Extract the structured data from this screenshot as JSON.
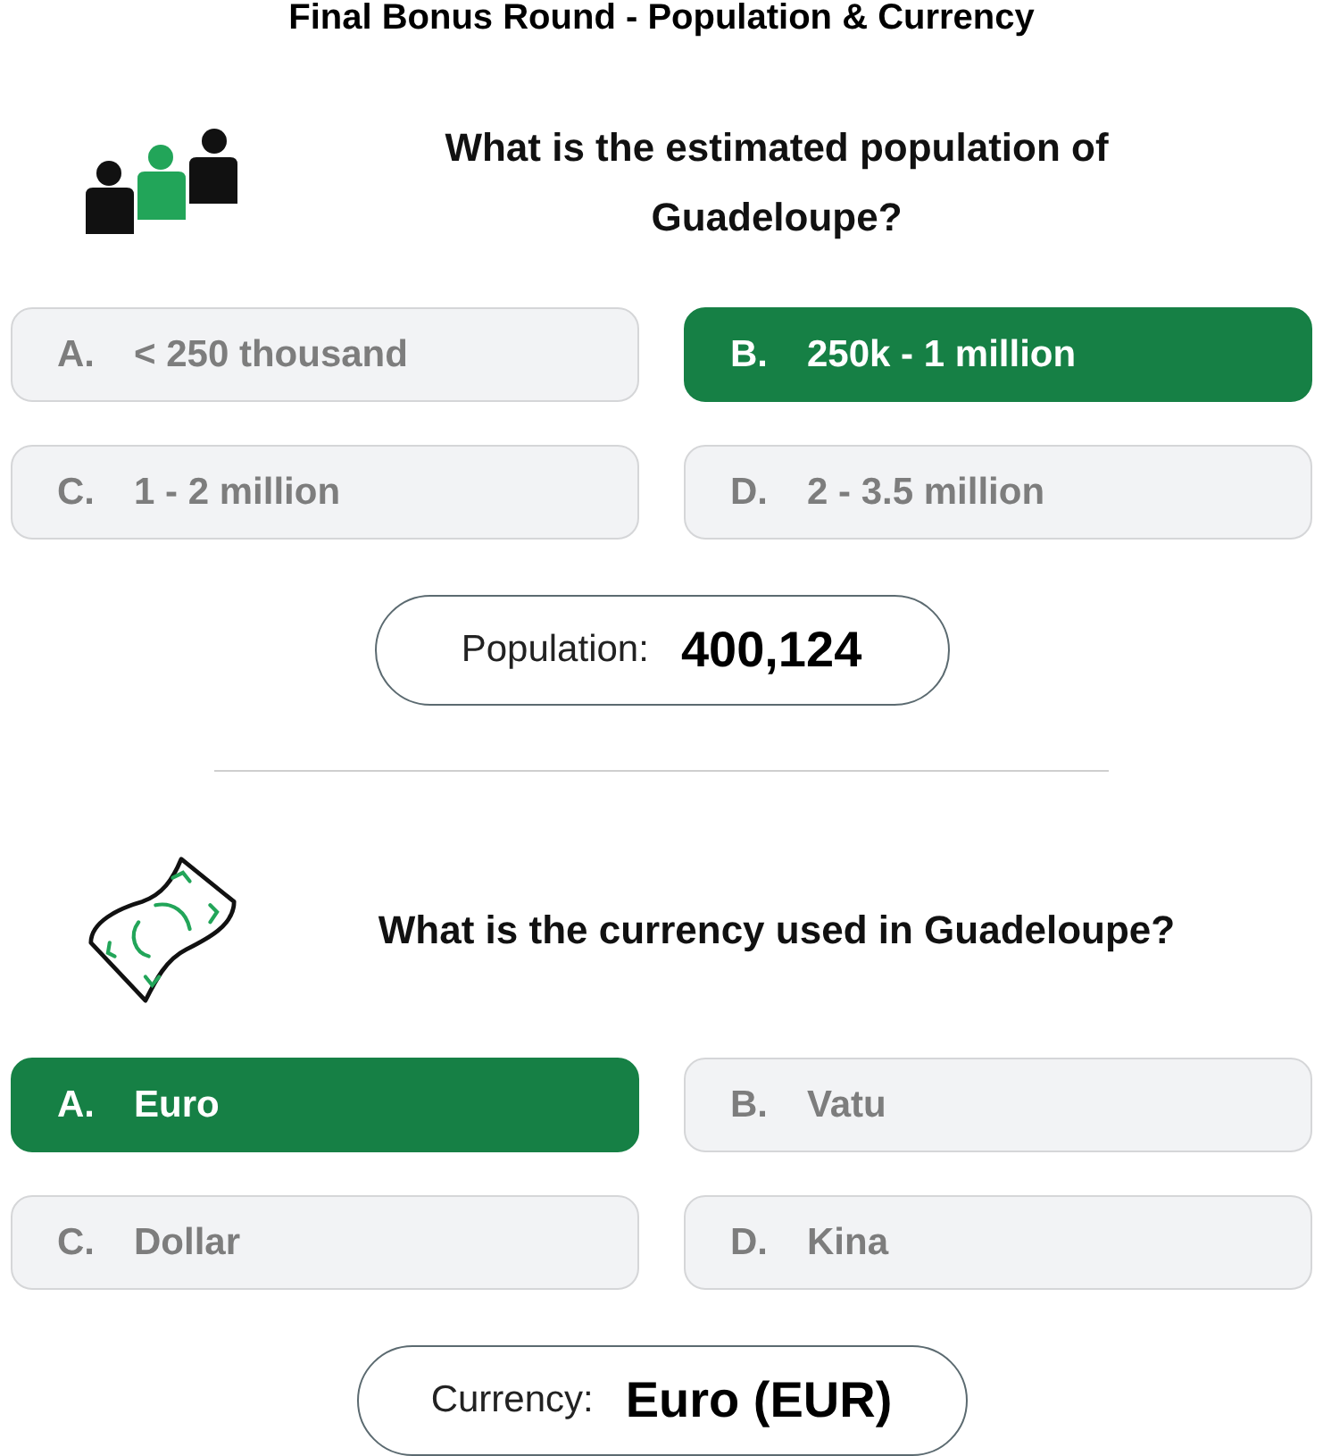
{
  "title": "Final Bonus Round - Population & Currency",
  "questions": [
    {
      "kind": "population",
      "question": "What is the estimated population of Guadeloupe?",
      "options": [
        {
          "letter": "A.",
          "text": "< 250 thousand",
          "selected": false
        },
        {
          "letter": "B.",
          "text": "250k - 1 million",
          "selected": true
        },
        {
          "letter": "C.",
          "text": "1 - 2 million",
          "selected": false
        },
        {
          "letter": "D.",
          "text": "2 - 3.5 million",
          "selected": false
        }
      ],
      "answer": {
        "label": "Population:",
        "value": "400,124"
      }
    },
    {
      "kind": "currency",
      "question": "What is the currency used in Guadeloupe?",
      "options": [
        {
          "letter": "A.",
          "text": "Euro",
          "selected": true
        },
        {
          "letter": "B.",
          "text": "Vatu",
          "selected": false
        },
        {
          "letter": "C.",
          "text": "Dollar",
          "selected": false
        },
        {
          "letter": "D.",
          "text": "Kina",
          "selected": false
        }
      ],
      "answer": {
        "label": "Currency:",
        "value": "Euro (EUR)"
      }
    }
  ]
}
